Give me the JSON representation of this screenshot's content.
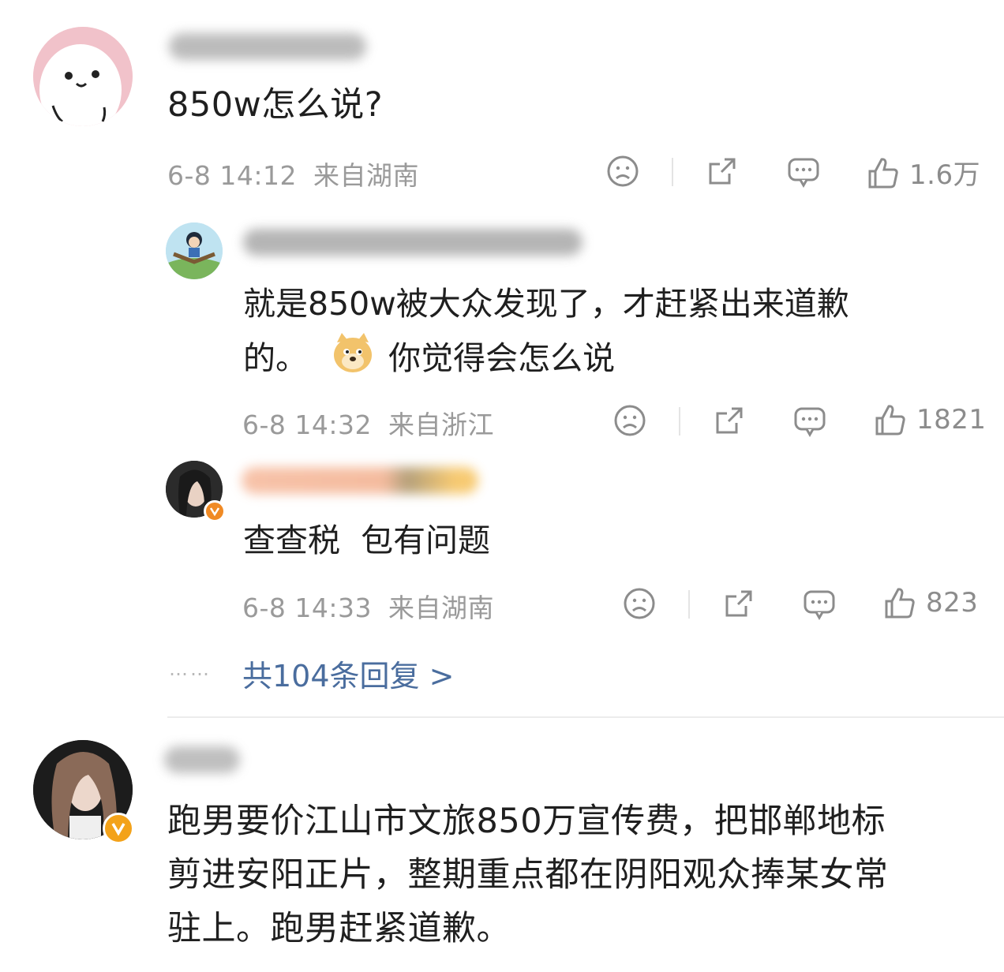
{
  "comments": [
    {
      "text": "850w怎么说?",
      "time": "6-8 14:12",
      "location": "来自湖南",
      "likes": "1.6万"
    }
  ],
  "replies": [
    {
      "text_line1": "就是850w被大众发现了，才赶紧出来道歉",
      "text_line2": "的。",
      "text_line2_rest": "你觉得会怎么说",
      "time": "6-8 14:32",
      "location": "来自浙江",
      "likes": "1821"
    },
    {
      "text": "查查税  包有问题",
      "time": "6-8 14:33",
      "location": "来自湖南",
      "likes": "823"
    }
  ],
  "reply_summary": {
    "dots": "……",
    "label": "共104条回复 >"
  },
  "second_comment": {
    "line1": "跑男要价江山市文旅850万宣传费，把邯郸地标",
    "line2": "剪进安阳正片，整期重点都在阴阳观众捧某女常",
    "line3": "驻上。跑男赶紧道歉。"
  },
  "icons": {
    "dislike": "sad-face-icon",
    "share": "share-icon",
    "comment": "comment-icon",
    "like": "thumbs-up-icon",
    "verified": "verified-v-icon"
  },
  "colors": {
    "link": "#4a6d9e",
    "meta": "#9a9a9a",
    "verified": "#f3a21a"
  }
}
